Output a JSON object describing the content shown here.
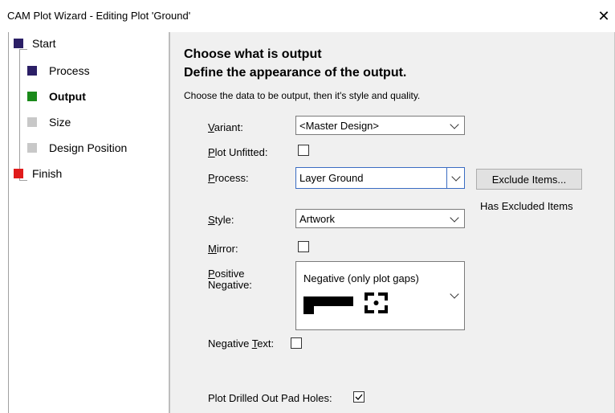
{
  "window": {
    "title": "CAM Plot Wizard - Editing Plot 'Ground'",
    "close_glyph": "✕"
  },
  "steps": [
    {
      "label": "Start",
      "color": "#2b1f66"
    },
    {
      "label": "Process",
      "color": "#2b1f66"
    },
    {
      "label": "Output",
      "color": "#1a8a1a"
    },
    {
      "label": "Size",
      "color": "#c8c8c8"
    },
    {
      "label": "Design Position",
      "color": "#c8c8c8"
    },
    {
      "label": "Finish",
      "color": "#e01b1b"
    }
  ],
  "page": {
    "heading1": "Choose what is output",
    "heading2": "Define the appearance of the output.",
    "subtitle": "Choose the data to be output, then it's style and quality."
  },
  "fields": {
    "variant": {
      "label_u": "V",
      "label_rest": "ariant:",
      "value": "<Master Design>"
    },
    "plot_unfitted": {
      "label_u": "P",
      "label_rest": "lot Unfitted:",
      "checked": false
    },
    "process": {
      "label_u": "P",
      "label_rest": "rocess:",
      "value": "Layer Ground"
    },
    "exclude_button": "Exclude Items...",
    "excluded_note": "Has Excluded Items",
    "style": {
      "label_u": "S",
      "label_rest": "tyle:",
      "value": "Artwork"
    },
    "mirror": {
      "label_u": "M",
      "label_rest": "irror:",
      "checked": false
    },
    "positive_negative": {
      "label_line1_u": "P",
      "label_line1_rest": "ositive",
      "label_line2": "Negative:",
      "value": "Negative (only plot gaps)"
    },
    "negative_text": {
      "label_before": "Negative ",
      "label_u": "T",
      "label_rest": "ext:",
      "checked": false
    },
    "plot_drilled": {
      "label": "Plot Drilled Out Pad Holes:",
      "checked": true
    }
  }
}
